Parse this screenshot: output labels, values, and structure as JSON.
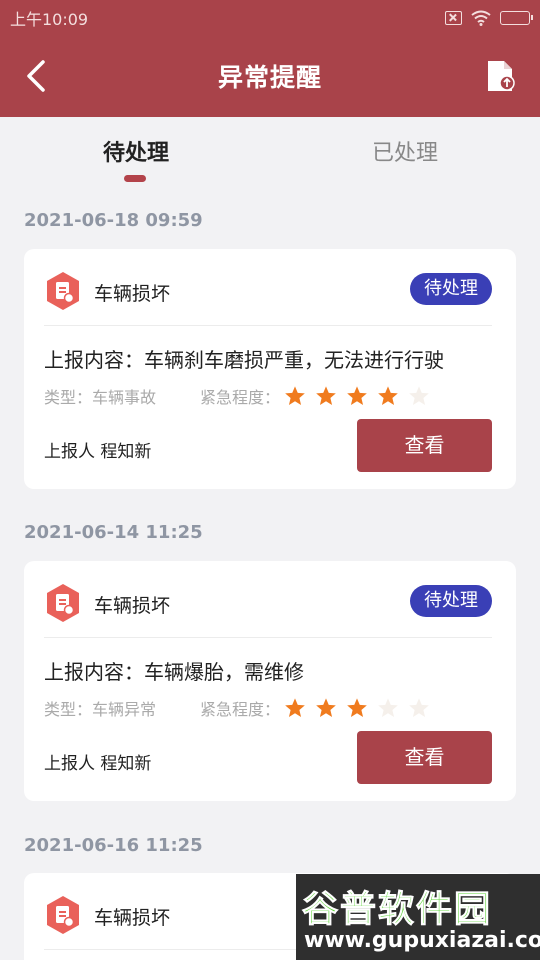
{
  "status_bar": {
    "time": "上午10:09"
  },
  "header": {
    "title": "异常提醒"
  },
  "tabs": [
    {
      "label": "待处理",
      "active": true
    },
    {
      "label": "已处理",
      "active": false
    }
  ],
  "records": [
    {
      "date": "2021-06-18 09:59",
      "title": "车辆损坏",
      "status": "待处理",
      "content": "上报内容：车辆刹车磨损严重，无法进行行驶",
      "type": "类型：车辆事故",
      "urgency_label": "紧急程度：",
      "urgency": 4,
      "reporter": "上报人 程知新",
      "action": "查看"
    },
    {
      "date": "2021-06-14 11:25",
      "title": "车辆损坏",
      "status": "待处理",
      "content": "上报内容：车辆爆胎，需维修",
      "type": "类型：车辆异常",
      "urgency_label": "紧急程度：",
      "urgency": 3,
      "reporter": "上报人 程知新",
      "action": "查看"
    },
    {
      "date": "2021-06-16 11:25",
      "title": "车辆损坏"
    }
  ],
  "urgency_max": 5,
  "colors": {
    "accent": "#a9434a",
    "badge": "#3a3fb6",
    "star_on": "#f07b1e",
    "star_off": "#f5f0eb"
  },
  "watermark": {
    "top": "谷普软件园",
    "bottom": "www.gupuxiazai.com"
  }
}
